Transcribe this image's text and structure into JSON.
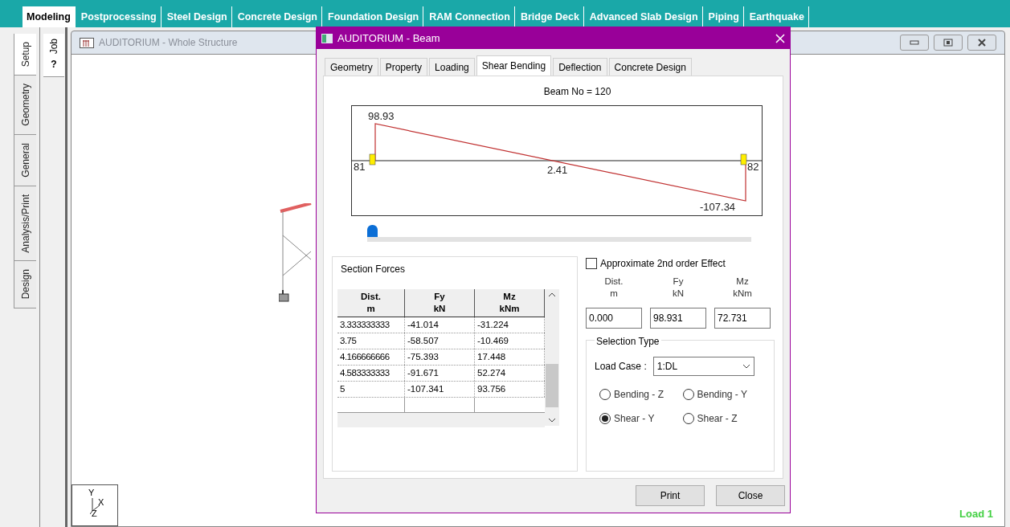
{
  "ribbon_tabs": [
    {
      "label": "Modeling",
      "selected": true
    },
    {
      "label": "Postprocessing",
      "selected": false
    },
    {
      "label": "Steel Design",
      "selected": false
    },
    {
      "label": "Concrete Design",
      "selected": false
    },
    {
      "label": "Foundation Design",
      "selected": false
    },
    {
      "label": "RAM Connection",
      "selected": false
    },
    {
      "label": "Bridge Deck",
      "selected": false
    },
    {
      "label": "Advanced Slab Design",
      "selected": false
    },
    {
      "label": "Piping",
      "selected": false
    },
    {
      "label": "Earthquake",
      "selected": false
    }
  ],
  "side_tabs": [
    {
      "label": "Setup",
      "selected": true
    },
    {
      "label": "Geometry",
      "selected": false
    },
    {
      "label": "General",
      "selected": false
    },
    {
      "label": "Analysis/Print",
      "selected": false
    },
    {
      "label": "Design",
      "selected": false
    }
  ],
  "job_tab": {
    "label": "Job",
    "glyph": "?"
  },
  "view_window": {
    "title": "AUDITORIUM - Whole Structure",
    "load_label": "Load 1",
    "axes": {
      "y": "Y",
      "x": "X",
      "z": "Z"
    }
  },
  "dialog": {
    "title": "AUDITORIUM - Beam",
    "tabs": [
      {
        "label": "Geometry",
        "selected": false
      },
      {
        "label": "Property",
        "selected": false
      },
      {
        "label": "Loading",
        "selected": false
      },
      {
        "label": "Shear Bending",
        "selected": true
      },
      {
        "label": "Deflection",
        "selected": false
      },
      {
        "label": "Concrete Design",
        "selected": false
      }
    ],
    "beam_label": "Beam No = 120",
    "diagram": {
      "start_value": "98.93",
      "mid_value": "2.41",
      "end_value": "-107.34",
      "start_node": "81",
      "end_node": "82"
    },
    "slider": {
      "level": 0
    },
    "section_forces": {
      "title": "Section Forces",
      "columns": [
        {
          "name": "Dist.",
          "unit": "m"
        },
        {
          "name": "Fy",
          "unit": "kN"
        },
        {
          "name": "Mz",
          "unit": "kNm"
        }
      ],
      "rows": [
        [
          "3.333333333",
          "-41.014",
          "-31.224"
        ],
        [
          "3.75",
          "-58.507",
          "-10.469"
        ],
        [
          "4.166666666",
          "-75.393",
          "17.448"
        ],
        [
          "4.583333333",
          "-91.671",
          "52.274"
        ],
        [
          "5",
          "-107.341",
          "93.756"
        ]
      ]
    },
    "second_order": {
      "label": "Approximate 2nd order Effect",
      "checked": false
    },
    "point_values": [
      {
        "name": "Dist.",
        "unit": "m",
        "value": "0.000"
      },
      {
        "name": "Fy",
        "unit": "kN",
        "value": "98.931"
      },
      {
        "name": "Mz",
        "unit": "kNm",
        "value": "72.731"
      }
    ],
    "selection_type": {
      "title": "Selection Type",
      "load_case_label": "Load Case :",
      "load_case": "1:DL",
      "options": [
        {
          "label": "Bending - Z",
          "selected": false
        },
        {
          "label": "Bending - Y",
          "selected": false
        },
        {
          "label": "Shear - Y",
          "selected": true
        },
        {
          "label": "Shear - Z",
          "selected": false
        }
      ]
    },
    "buttons": [
      "Print",
      "Close"
    ]
  }
}
